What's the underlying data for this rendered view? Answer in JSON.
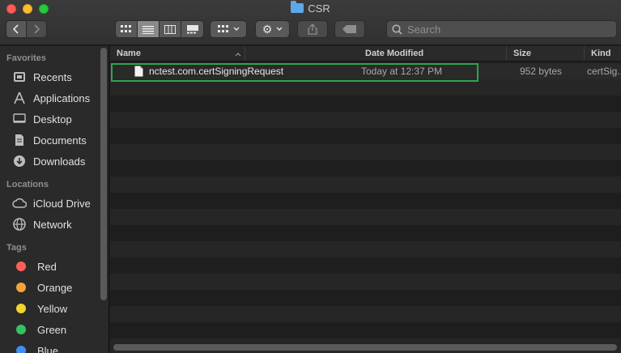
{
  "window": {
    "title": "CSR"
  },
  "toolbar": {
    "back_icon": "chevron-left-icon",
    "forward_icon": "chevron-right-icon",
    "view_modes": [
      "icon-view-icon",
      "list-view-icon",
      "column-view-icon",
      "gallery-view-icon"
    ],
    "active_view": "list",
    "group_icon": "group-by-icon",
    "action_icon": "gear-icon",
    "share_icon": "share-icon",
    "tag_icon": "tag-icon"
  },
  "search": {
    "placeholder": "Search"
  },
  "sidebar": {
    "sections": [
      {
        "heading": "Favorites",
        "items": [
          {
            "label": "Recents",
            "icon": "clock-icon"
          },
          {
            "label": "Applications",
            "icon": "applications-icon"
          },
          {
            "label": "Desktop",
            "icon": "desktop-icon"
          },
          {
            "label": "Documents",
            "icon": "document-icon"
          },
          {
            "label": "Downloads",
            "icon": "download-icon"
          }
        ]
      },
      {
        "heading": "Locations",
        "items": [
          {
            "label": "iCloud Drive",
            "icon": "cloud-icon"
          },
          {
            "label": "Network",
            "icon": "globe-icon"
          }
        ]
      },
      {
        "heading": "Tags",
        "items": [
          {
            "label": "Red",
            "color": "#fe5f57"
          },
          {
            "label": "Orange",
            "color": "#f7a33a"
          },
          {
            "label": "Yellow",
            "color": "#f3d32c"
          },
          {
            "label": "Green",
            "color": "#36c25e"
          },
          {
            "label": "Blue",
            "color": "#3e8ef7"
          }
        ]
      }
    ]
  },
  "columns": {
    "name": "Name",
    "date": "Date Modified",
    "size": "Size",
    "kind": "Kind"
  },
  "files": [
    {
      "name": "nctest.com.certSigningRequest",
      "date": "Today at 12:37 PM",
      "size": "952 bytes",
      "kind": "certSig..."
    }
  ],
  "colors": {
    "highlight": "#2ea44f"
  }
}
